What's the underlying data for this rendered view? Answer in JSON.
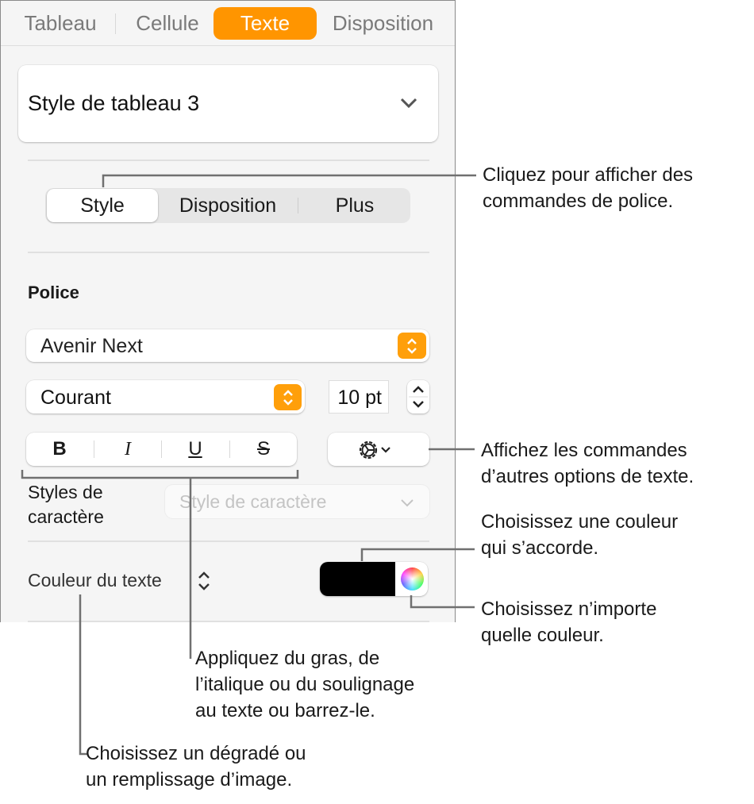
{
  "tabs": [
    {
      "label": "Tableau"
    },
    {
      "label": "Cellule"
    },
    {
      "label": "Texte",
      "selected": true
    },
    {
      "label": "Disposition"
    }
  ],
  "table_style": "Style de tableau 3",
  "segments": [
    {
      "label": "Style",
      "selected": true
    },
    {
      "label": "Disposition"
    },
    {
      "label": "Plus"
    }
  ],
  "font_section": "Police",
  "font_family": "Avenir Next",
  "font_weight": "Courant",
  "font_size": "10 pt",
  "format_buttons": {
    "bold": "B",
    "italic": "I",
    "underline": "U",
    "strike": "S"
  },
  "char_styles_label": [
    "Styles de",
    "caractère"
  ],
  "char_style_placeholder": "Style de caractère",
  "text_color_label": "Couleur du texte",
  "text_color": "#000000",
  "accent": "#ff9500",
  "callouts": {
    "style_tab": [
      "Cliquez pour afficher des",
      "commandes de police."
    ],
    "gear": [
      "Affichez les commandes",
      "d’autres options de texte."
    ],
    "well": [
      "Choisissez une couleur",
      "qui s’accorde."
    ],
    "wheel": [
      "Choisissez n’importe",
      "quelle couleur."
    ],
    "format": [
      "Appliquez du gras, de",
      "l’italique ou du soulignage",
      "au texte ou barrez-le."
    ],
    "fill": [
      "Choisissez un dégradé ou",
      "un remplissage d’image."
    ]
  }
}
